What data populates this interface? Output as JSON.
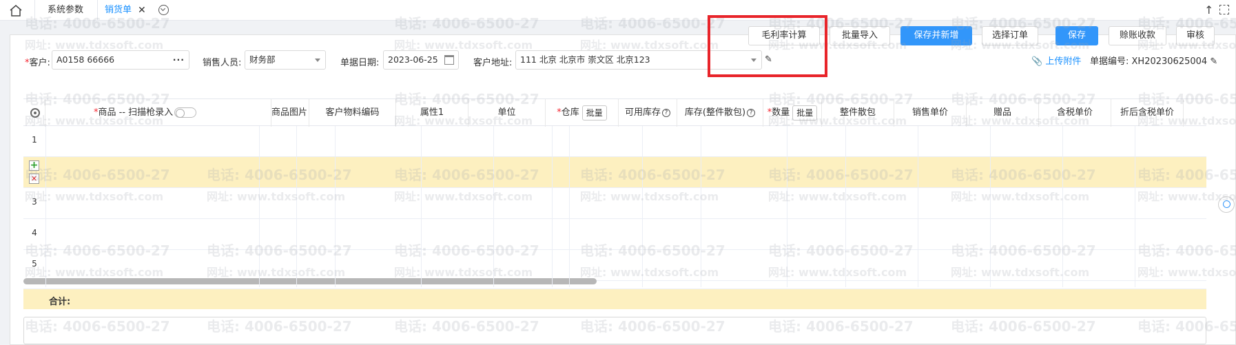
{
  "tabs": {
    "home_icon": "home-icon",
    "items": [
      {
        "label": "系统参数"
      },
      {
        "label": "销货单",
        "close": "✕"
      }
    ]
  },
  "toolbar": {
    "margin_calc": "毛利率计算",
    "batch_import": "批量导入",
    "save_new": "保存并新增",
    "select_order": "选择订单",
    "save": "保存",
    "credit_receipt": "赊账收款",
    "audit": "审核"
  },
  "form": {
    "customer_label": "客户:",
    "customer_value": "A0158 66666",
    "customer_dots": "···",
    "sales_label": "销售人员:",
    "sales_value": "财务部",
    "date_label": "单据日期:",
    "date_value": "2023-06-25",
    "address_label": "客户地址:",
    "address_value": "111 北京 北京市 崇文区 北京123",
    "upload_label": "上传附件",
    "doc_no": "单据编号: XH20230625004"
  },
  "grid": {
    "headers": {
      "product": "商品 -- 扫描枪录入",
      "image": "商品图片",
      "cust_code": "客户物料编码",
      "attr1": "属性1",
      "unit": "单位",
      "warehouse": "仓库",
      "batch": "批量",
      "avail": "可用库存",
      "stock": "库存(整件散包)",
      "qty": "数量",
      "pack": "整件散包",
      "price": "销售单价",
      "gift": "赠品",
      "tax_price": "含税单价",
      "disc_tax_price": "折后含税单价"
    },
    "row_numbers": [
      "1",
      "",
      "3",
      "4",
      "5"
    ],
    "total_label": "合计:"
  },
  "watermark": {
    "phone": "电话: 4006-6500-27",
    "site": "网址: www.tdxsoft.com"
  },
  "colors": {
    "primary": "#3296fa",
    "highlight_row": "#fdf0c0",
    "red_box": "#e8242a"
  }
}
